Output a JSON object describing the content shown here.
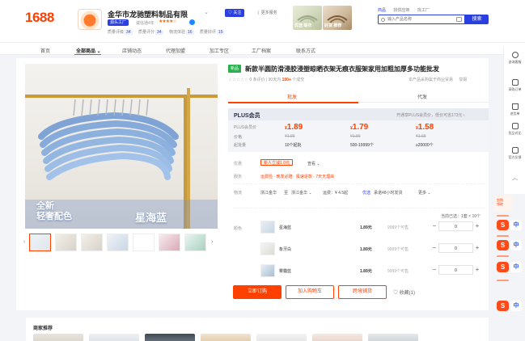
{
  "brand": {
    "logo_text": "1688",
    "accent": "#ff4000",
    "blue": "#2a3fe0"
  },
  "shop": {
    "name": "金华市龙驰塑料制品有限",
    "badge": "源头工厂",
    "years": "诚信通4年",
    "rating_stars": "★★★★☆",
    "metrics": [
      {
        "label": "质量评级",
        "value": "34"
      },
      {
        "label": "质量评分",
        "value": "34"
      },
      {
        "label": "物流体验",
        "value": "16"
      },
      {
        "label": "质量好评",
        "value": "15"
      }
    ],
    "subscribe_label": "♡ 关注",
    "more_label": "❘ 更多服务"
  },
  "header_thumbs": [
    {
      "label": "优选 晾衣"
    },
    {
      "label": "好货 推荐"
    }
  ],
  "search": {
    "tabs": [
      "商品",
      "找供应商",
      "找工厂"
    ],
    "active_tab": 0,
    "placeholder": "输入产品名称",
    "button_label": "搜索"
  },
  "nav": {
    "items": [
      "首页",
      "全部商品 ⌄",
      "店铺动态",
      "代理加盟",
      "加工专区",
      "工厂档案",
      "联系方式"
    ],
    "active": 1
  },
  "product": {
    "new_tag": "新品",
    "title": "新款半圆防滑浸胶浸塑晾晒衣架无痕衣服架家用加粗加厚多功能批发",
    "rating": "☆☆☆☆☆",
    "review_label": "0 条评价",
    "sales_label": "90天内",
    "sales_value": "100+",
    "sales_unit": "个成交",
    "right_note": "本产品采购属于商业贸易",
    "report": "举报",
    "image_caption_left": "全新\n轻奢配色",
    "image_caption_right": "星海蓝",
    "tabs": [
      "批发",
      "代发"
    ],
    "active_tab": 0
  },
  "plus": {
    "title": "PLUS会员",
    "note": "开通享PLUS会员价，低价可省173元 ›",
    "row_labels": [
      "PLUS会员价",
      "价格",
      "起批量"
    ],
    "tiers": [
      {
        "plus_price": "1.89",
        "orig_price": "¥1.99",
        "moq": "10个起批"
      },
      {
        "plus_price": "1.79",
        "orig_price": "¥1.89",
        "moq": "500-19999个"
      },
      {
        "plus_price": "1.58",
        "orig_price": "¥1.68",
        "moq": "≥20000个"
      }
    ]
  },
  "offers": {
    "label": "优惠",
    "coupon": "新人立减1.0元",
    "coupon_more": "查看 ⌄"
  },
  "service": {
    "label": "服务",
    "items": "运费险 · 晚发必赔 · 极速退款 · 7天无理由"
  },
  "logistics": {
    "label": "物流",
    "from": "浙江金华",
    "to_label": "至",
    "to": "浙江金华 ⌄",
    "fee": "运费：¥ 4.5起",
    "express_label": "优选",
    "ship_time": "承诺48小时发货",
    "more": "更多 ⌄"
  },
  "sku": {
    "label": "颜色",
    "select_hint": "当前已选：1套 × 10个",
    "rows": [
      {
        "name": "星海蓝",
        "price": "1.89元",
        "stock": "9989个可售",
        "qty": "0"
      },
      {
        "name": "象牙白",
        "price": "1.89元",
        "stock": "9999个可售",
        "qty": "0"
      },
      {
        "name": "雾霾蓝",
        "price": "1.89元",
        "stock": "9999个可售",
        "qty": "0"
      }
    ]
  },
  "actions": {
    "order": "立即订购",
    "cart": "加入购物车",
    "cross": "跨境铺货",
    "favorite": "♡ 收藏(1)"
  },
  "recommend": {
    "title": "商家推荐"
  },
  "sidebar": {
    "items": [
      "咨询客服",
      "采购订单",
      "进货单",
      "货品对比",
      "官方反馈"
    ],
    "float_label": "加购\n领取"
  }
}
